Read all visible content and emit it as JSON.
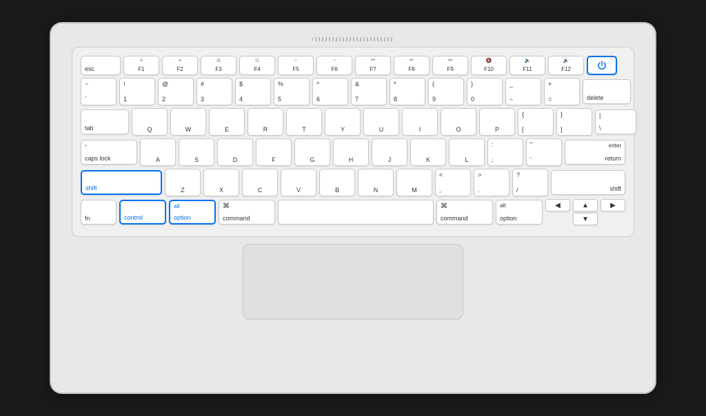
{
  "keyboard": {
    "fn_row": [
      {
        "label": "esc",
        "width": "esc-key"
      },
      {
        "top": "✦",
        "label": "F1"
      },
      {
        "top": "✦",
        "label": "F2"
      },
      {
        "top": "▤",
        "label": "F3"
      },
      {
        "top": "⊞",
        "label": "F4"
      },
      {
        "top": "✦",
        "label": "F5"
      },
      {
        "top": "✦",
        "label": "F6"
      },
      {
        "top": "◁◁",
        "label": "F7"
      },
      {
        "top": "▷||",
        "label": "F8"
      },
      {
        "top": "▷▷",
        "label": "F9"
      },
      {
        "top": "✦",
        "label": "F10"
      },
      {
        "top": "✦",
        "label": "F11"
      },
      {
        "top": "✦",
        "label": "F12"
      },
      {
        "label": "power",
        "isPower": true
      }
    ],
    "num_row": [
      {
        "top": "~",
        "bottom": "`"
      },
      {
        "top": "!",
        "bottom": "1"
      },
      {
        "top": "@",
        "bottom": "2"
      },
      {
        "top": "#",
        "bottom": "3"
      },
      {
        "top": "$",
        "bottom": "4"
      },
      {
        "top": "%",
        "bottom": "5"
      },
      {
        "top": "^",
        "bottom": "6"
      },
      {
        "top": "&",
        "bottom": "7"
      },
      {
        "top": "*",
        "bottom": "8"
      },
      {
        "top": "(",
        "bottom": "9"
      },
      {
        "top": ")",
        "bottom": "0"
      },
      {
        "top": "_",
        "bottom": "–"
      },
      {
        "top": "+",
        "bottom": "="
      },
      {
        "label": "delete"
      }
    ],
    "row1": [
      "Q",
      "W",
      "E",
      "R",
      "T",
      "Y",
      "U",
      "I",
      "O",
      "P"
    ],
    "row1_right": [
      {
        "top": "{",
        "bottom": "["
      },
      {
        "top": "}",
        "bottom": "]"
      },
      {
        "top": "|",
        "bottom": "\\"
      }
    ],
    "row2": [
      "A",
      "S",
      "D",
      "F",
      "G",
      "H",
      "J",
      "K",
      "L"
    ],
    "row2_right": [
      {
        "top": ":",
        "bottom": ";"
      },
      {
        "top": "\"",
        "bottom": "'"
      }
    ],
    "row3": [
      "Z",
      "X",
      "C",
      "V",
      "B",
      "N",
      "M"
    ],
    "row3_right": [
      {
        "top": "<",
        "bottom": ","
      },
      {
        "top": ">",
        "bottom": "."
      },
      {
        "top": "?",
        "bottom": "/"
      }
    ],
    "bottom_row": {
      "fn": "fn",
      "control": "control",
      "option_top": "alt",
      "option_bottom": "option",
      "command_sym": "⌘",
      "command": "command",
      "command_sym_r": "⌘",
      "command_r": "command",
      "option_top_r": "alt",
      "option_r": "option"
    },
    "arrows": {
      "left": "◀",
      "right": "▶",
      "up": "▲",
      "down": "▼"
    }
  }
}
